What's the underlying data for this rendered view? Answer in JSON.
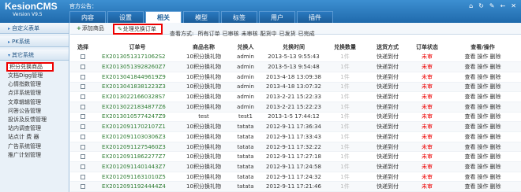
{
  "app": {
    "logo_title": "KesionCMS",
    "logo_sub": "Version V9.5",
    "announcement": "官方公告："
  },
  "nav": {
    "tabs": [
      "内容",
      "设置",
      "相关",
      "模型",
      "标签",
      "用户",
      "插件"
    ],
    "active_index": 2
  },
  "top_icons": [
    "home-icon",
    "refresh-icon",
    "settings-icon",
    "back-icon",
    "close-icon"
  ],
  "sidebar": {
    "sections": [
      "自定义表单",
      "PK系统",
      "其它系统"
    ],
    "items": [
      "积分兑换商品",
      "文档Digg管理",
      "心情指数管理",
      "点评系统管理",
      "文章辑辑管理",
      "问答公告管理",
      "投诉及反馈管理",
      "站内调查管理",
      "站点计 费 器",
      "广告系统管理",
      "推广计划管理"
    ],
    "selected_index": 0
  },
  "toolbar": {
    "add_label": "添加商品",
    "process_label": "处理兑换订单",
    "filter_label": "查看方式:",
    "filters": [
      "所有订单",
      "已审核",
      "未审核",
      "配货中",
      "已发货",
      "已完成"
    ]
  },
  "table": {
    "headers": [
      "选择",
      "订单号",
      "商品名称",
      "兑换人",
      "兑换时间",
      "兑换数量",
      "送货方式",
      "订单状态",
      "查看/操作"
    ],
    "ops": [
      "查看",
      "操作",
      "删除"
    ],
    "rows": [
      {
        "sn": "EX20130513171062S2",
        "name": "10积分换礼物",
        "user": "admin",
        "time": "2013-5-13 9:55:43",
        "qty": "1件",
        "ship": "快递到付",
        "status": "未审"
      },
      {
        "sn": "EX20130513928260Z7",
        "name": "10积分换礼物",
        "user": "admin",
        "time": "2013-5-13 9:54:48",
        "qty": "1件",
        "ship": "快递到付",
        "status": "未审"
      },
      {
        "sn": "EX20130418449619Z9",
        "name": "10积分换礼物",
        "user": "admin",
        "time": "2013-4-18 13:09:38",
        "qty": "1件",
        "ship": "快递到付",
        "status": "未审"
      },
      {
        "sn": "EX20130418381223Z3",
        "name": "10积分换礼物",
        "user": "admin",
        "time": "2013-4-18 13:07:32",
        "qty": "1件",
        "ship": "快递到付",
        "status": "未审"
      },
      {
        "sn": "EX20130221660328S7",
        "name": "10积分换礼物",
        "user": "admin",
        "time": "2013-2-21 15:22:33",
        "qty": "1件",
        "ship": "快递到付",
        "status": "未审"
      },
      {
        "sn": "EX20130221834877Z6",
        "name": "10积分换礼物",
        "user": "admin",
        "time": "2013-2-21 15:22:23",
        "qty": "1件",
        "ship": "快递到付",
        "status": "未审"
      },
      {
        "sn": "EX20130105774247Z9",
        "name": "test",
        "user": "test1",
        "time": "2013-1-5 17:44:12",
        "qty": "1件",
        "ship": "快递到付",
        "status": "未审"
      },
      {
        "sn": "EX20120911702107Z1",
        "name": "10积分换礼物",
        "user": "tatata",
        "time": "2012-9-11 17:36:34",
        "qty": "1件",
        "ship": "快递到付",
        "status": "未审"
      },
      {
        "sn": "EX20120911030306Z3",
        "name": "10积分换礼物",
        "user": "tatata",
        "time": "2012-9-11 17:33:43",
        "qty": "1件",
        "ship": "快递到付",
        "status": "未审"
      },
      {
        "sn": "EX20120911275460Z3",
        "name": "10积分换礼物",
        "user": "tatata",
        "time": "2012-9-11 17:32:22",
        "qty": "1件",
        "ship": "快递到付",
        "status": "未审"
      },
      {
        "sn": "EX20120911862277Z7",
        "name": "10积分换礼物",
        "user": "tatata",
        "time": "2012-9-11 17:27:18",
        "qty": "1件",
        "ship": "快递到付",
        "status": "未审"
      },
      {
        "sn": "EX20120911401443Z7",
        "name": "10积分换礼物",
        "user": "tatata",
        "time": "2012-9-11 17:24:58",
        "qty": "1件",
        "ship": "快递到付",
        "status": "未审"
      },
      {
        "sn": "EX20120911631010Z5",
        "name": "10积分换礼物",
        "user": "tatata",
        "time": "2012-9-11 17:24:32",
        "qty": "1件",
        "ship": "快递到付",
        "status": "未审"
      },
      {
        "sn": "EX20120911924444Z4",
        "name": "10积分换礼物",
        "user": "tatata",
        "time": "2012-9-11 17:21:46",
        "qty": "1件",
        "ship": "快递到付",
        "status": "未审"
      }
    ]
  },
  "colors": {
    "topbar": "#1f6aac",
    "order_number": "#2e7d32",
    "status_unreviewed": "#ee0000",
    "highlight_box": "#ee0000"
  }
}
